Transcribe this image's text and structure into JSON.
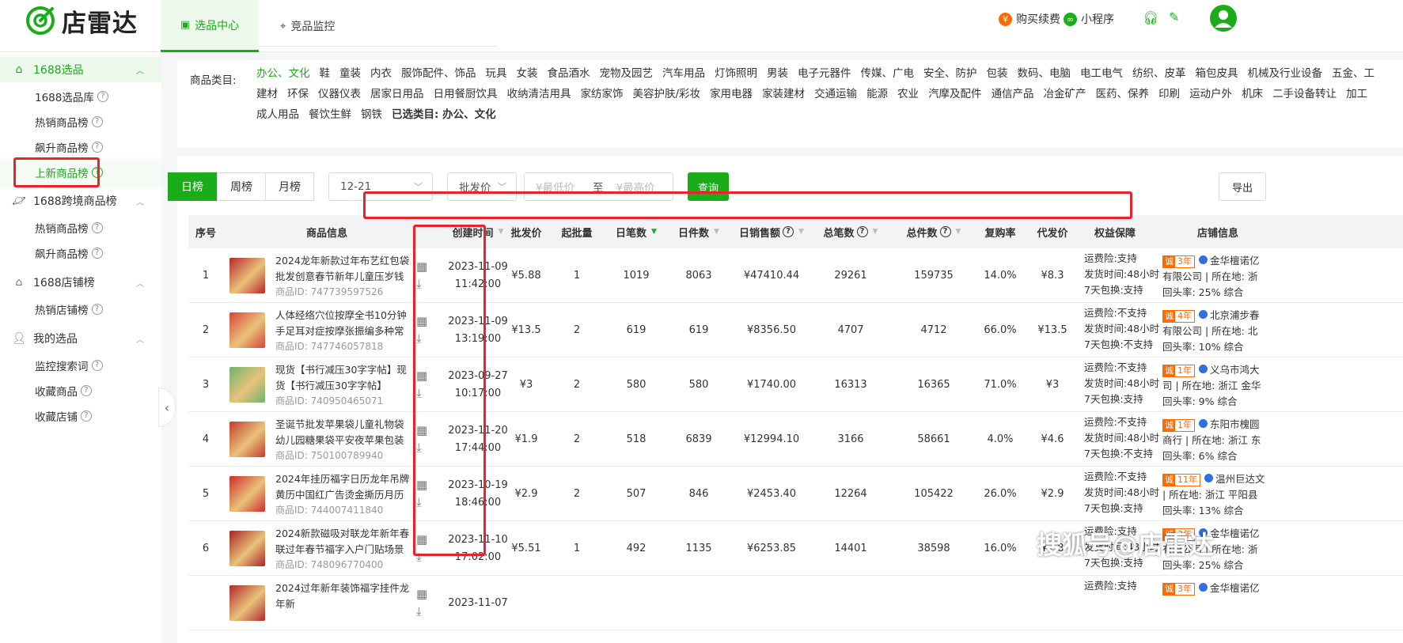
{
  "app": {
    "brand": "店雷达"
  },
  "colors": {
    "accent": "#1aad19",
    "highlight": "#e8232b",
    "orange": "#ff6a00",
    "blue": "#2f6fe0"
  },
  "header": {
    "tabs": [
      {
        "label": "选品中心",
        "icon": "bag-icon"
      },
      {
        "label": "竞品监控",
        "icon": "location-icon"
      }
    ],
    "right": {
      "renew": "购买续费",
      "miniprogram": "小程序"
    }
  },
  "sidebar": {
    "groups": [
      {
        "label": "1688选品",
        "items": [
          "1688选品库",
          "热销商品榜",
          "飙升商品榜",
          "上新商品榜"
        ]
      },
      {
        "label": "1688跨境商品榜",
        "items": [
          "热销商品榜",
          "飙升商品榜"
        ]
      },
      {
        "label": "1688店铺榜",
        "items": [
          "热销店铺榜"
        ]
      },
      {
        "label": "我的选品",
        "items": [
          "监控搜索词",
          "收藏商品",
          "收藏店铺"
        ]
      }
    ]
  },
  "categories": {
    "label": "商品类目:",
    "line1": [
      "办公、文化",
      "鞋",
      "童装",
      "内衣",
      "服饰配件、饰品",
      "玩具",
      "女装",
      "食品酒水",
      "宠物及园艺",
      "汽车用品",
      "灯饰照明",
      "男装",
      "电子元器件",
      "传媒、广电",
      "安全、防护",
      "包装",
      "数码、电脑",
      "电工电气",
      "纺织、皮革",
      "箱包皮具",
      "机械及行业设备",
      "五金、工"
    ],
    "line2": [
      "建材",
      "环保",
      "仪器仪表",
      "居家日用品",
      "日用餐厨饮具",
      "收纳清洁用具",
      "家纺家饰",
      "美容护肤/彩妆",
      "家用电器",
      "家装建材",
      "交通运输",
      "能源",
      "农业",
      "汽摩及配件",
      "通信产品",
      "冶金矿产",
      "医药、保养",
      "印刷",
      "运动户外",
      "机床",
      "二手设备转让",
      "加工"
    ],
    "line3": [
      "成人用品",
      "餐饮生鲜",
      "钢铁"
    ],
    "selected_label": "已选类目: 办公、文化"
  },
  "toolbar": {
    "ranges": [
      "日榜",
      "周榜",
      "月榜"
    ],
    "date": "12-21",
    "price_type": "批发价",
    "min_placeholder": "¥最低价",
    "to": "至",
    "max_placeholder": "¥最高价",
    "query": "查询",
    "export": "导出"
  },
  "table": {
    "headers": {
      "idx": "序号",
      "info": "商品信息",
      "created": "创建时间",
      "price": "批发价",
      "moq": "起批量",
      "day_orders": "日笔数",
      "day_pieces": "日件数",
      "day_sales": "日销售额",
      "total_orders": "总笔数",
      "total_pieces": "总件数",
      "repurchase": "复购率",
      "dropship": "代发价",
      "guarantee": "权益保障",
      "shop": "店铺信息"
    },
    "rows": [
      {
        "idx": "1",
        "name": "2024龙年新款过年布艺红包袋批发创意春节新年儿童压岁钱包利是封",
        "id": "商品ID: 747739597526",
        "date": "2023-11-09",
        "time": "11:42:00",
        "price": "¥5.88",
        "moq": "1",
        "day_orders": "1019",
        "day_pieces": "8063",
        "day_sales": "¥47410.44",
        "total_orders": "29261",
        "total_pieces": "159735",
        "repurchase": "14.0%",
        "dropship": "¥8.3",
        "g1": "运费险:支持",
        "g2": "发货时间:48小时",
        "g3": "7天包换:支持",
        "years": "3年",
        "s1": "金华檀诺亿",
        "s2": "有限公司 | 所在地: 浙",
        "s3": "回头率: 25%   综合",
        "thumb": "#b8262b"
      },
      {
        "idx": "2",
        "name": "人体经络穴位按摩全书10分钟手足耳对症按摩张振编多种常见病对症",
        "id": "商品ID: 747746057818",
        "date": "2023-11-09",
        "time": "13:19:00",
        "price": "¥13.5",
        "moq": "2",
        "day_orders": "619",
        "day_pieces": "619",
        "day_sales": "¥8356.50",
        "total_orders": "4707",
        "total_pieces": "4712",
        "repurchase": "66.0%",
        "dropship": "¥13.5",
        "g1": "运费险:不支持",
        "g2": "发货时间:48小时",
        "g3": "7天包换:不支持",
        "years": "4年",
        "s1": "北京浦步春",
        "s2": "有限公司 | 所在地: 北",
        "s3": "回头率: 10%   综合",
        "thumb": "#d9443a"
      },
      {
        "idx": "3",
        "name": "现货【书行减压30字字帖】现货【书行减压30字字帖】",
        "id": "商品ID: 740950465071",
        "date": "2023-09-27",
        "time": "10:17:00",
        "price": "¥3",
        "moq": "2",
        "day_orders": "580",
        "day_pieces": "580",
        "day_sales": "¥1740.00",
        "total_orders": "16313",
        "total_pieces": "16365",
        "repurchase": "71.0%",
        "dropship": "¥3",
        "g1": "运费险:不支持",
        "g2": "发货时间:48小时",
        "g3": "7天包换:支持",
        "years": "1年",
        "s1": "义乌市鸿大",
        "s2": "司 | 所在地: 浙江 金华",
        "s3": "回头率: 9%   综合",
        "thumb": "#6fb46a"
      },
      {
        "idx": "4",
        "name": "圣诞节批发苹果袋儿童礼物袋幼儿园糖果袋平安夜苹果包装礼盒束口",
        "id": "商品ID: 750100789940",
        "date": "2023-11-20",
        "time": "17:44:00",
        "price": "¥1.9",
        "moq": "2",
        "day_orders": "518",
        "day_pieces": "6839",
        "day_sales": "¥12994.10",
        "total_orders": "3166",
        "total_pieces": "58661",
        "repurchase": "4.0%",
        "dropship": "¥4.6",
        "g1": "运费险:不支持",
        "g2": "发货时间:48小时",
        "g3": "7天包换:不支持",
        "years": "1年",
        "s1": "东阳市槐圆",
        "s2": "商行 | 所在地: 浙江 东",
        "s3": "回头率: 6%   综合",
        "thumb": "#c43b2e"
      },
      {
        "idx": "5",
        "name": "2024年挂历福字日历龙年吊牌黄历中国红广告烫金撕历月历皇历定制",
        "id": "商品ID: 744007411840",
        "date": "2023-10-19",
        "time": "18:46:00",
        "price": "¥2.9",
        "moq": "2",
        "day_orders": "507",
        "day_pieces": "846",
        "day_sales": "¥2453.40",
        "total_orders": "12264",
        "total_pieces": "105422",
        "repurchase": "26.0%",
        "dropship": "¥2.9",
        "g1": "运费险:不支持",
        "g2": "发货时间:48小时",
        "g3": "7天包换:支持",
        "years": "11年",
        "s1": "温州巨达文",
        "s2": "| 所在地: 浙江 平阳县",
        "s3": "回头率: 13%   综合",
        "thumb": "#d02a2a"
      },
      {
        "idx": "6",
        "name": "2024新款磁吸对联龙年新年春联过年春节福字入户门贴场景布置装饰",
        "id": "商品ID: 748096770400",
        "date": "2023-11-10",
        "time": "17:02:00",
        "price": "¥5.51",
        "moq": "1",
        "day_orders": "492",
        "day_pieces": "1135",
        "day_sales": "¥6253.85",
        "total_orders": "14401",
        "total_pieces": "38598",
        "repurchase": "16.0%",
        "dropship": "¥7.8",
        "g1": "运费险:支持",
        "g2": "发货时间:48小时",
        "g3": "7天包换:支持",
        "years": "3年",
        "s1": "金华檀诺亿",
        "s2": "有限公司 | 所在地: 浙",
        "s3": "回头率: 25%   综合",
        "thumb": "#a82424"
      },
      {
        "idx": "",
        "name": "2024过年新年装饰福字挂件龙年新",
        "id": "",
        "date": "2023-11-07",
        "time": "",
        "price": "",
        "moq": "",
        "day_orders": "",
        "day_pieces": "",
        "day_sales": "",
        "total_orders": "",
        "total_pieces": "",
        "repurchase": "",
        "dropship": "",
        "g1": "运费险:支持",
        "g2": "",
        "g3": "",
        "years": "3年",
        "s1": "金华檀诺亿",
        "s2": "",
        "s3": "",
        "thumb": "#b3282b"
      }
    ]
  },
  "watermark": "搜狐号@店雷达"
}
